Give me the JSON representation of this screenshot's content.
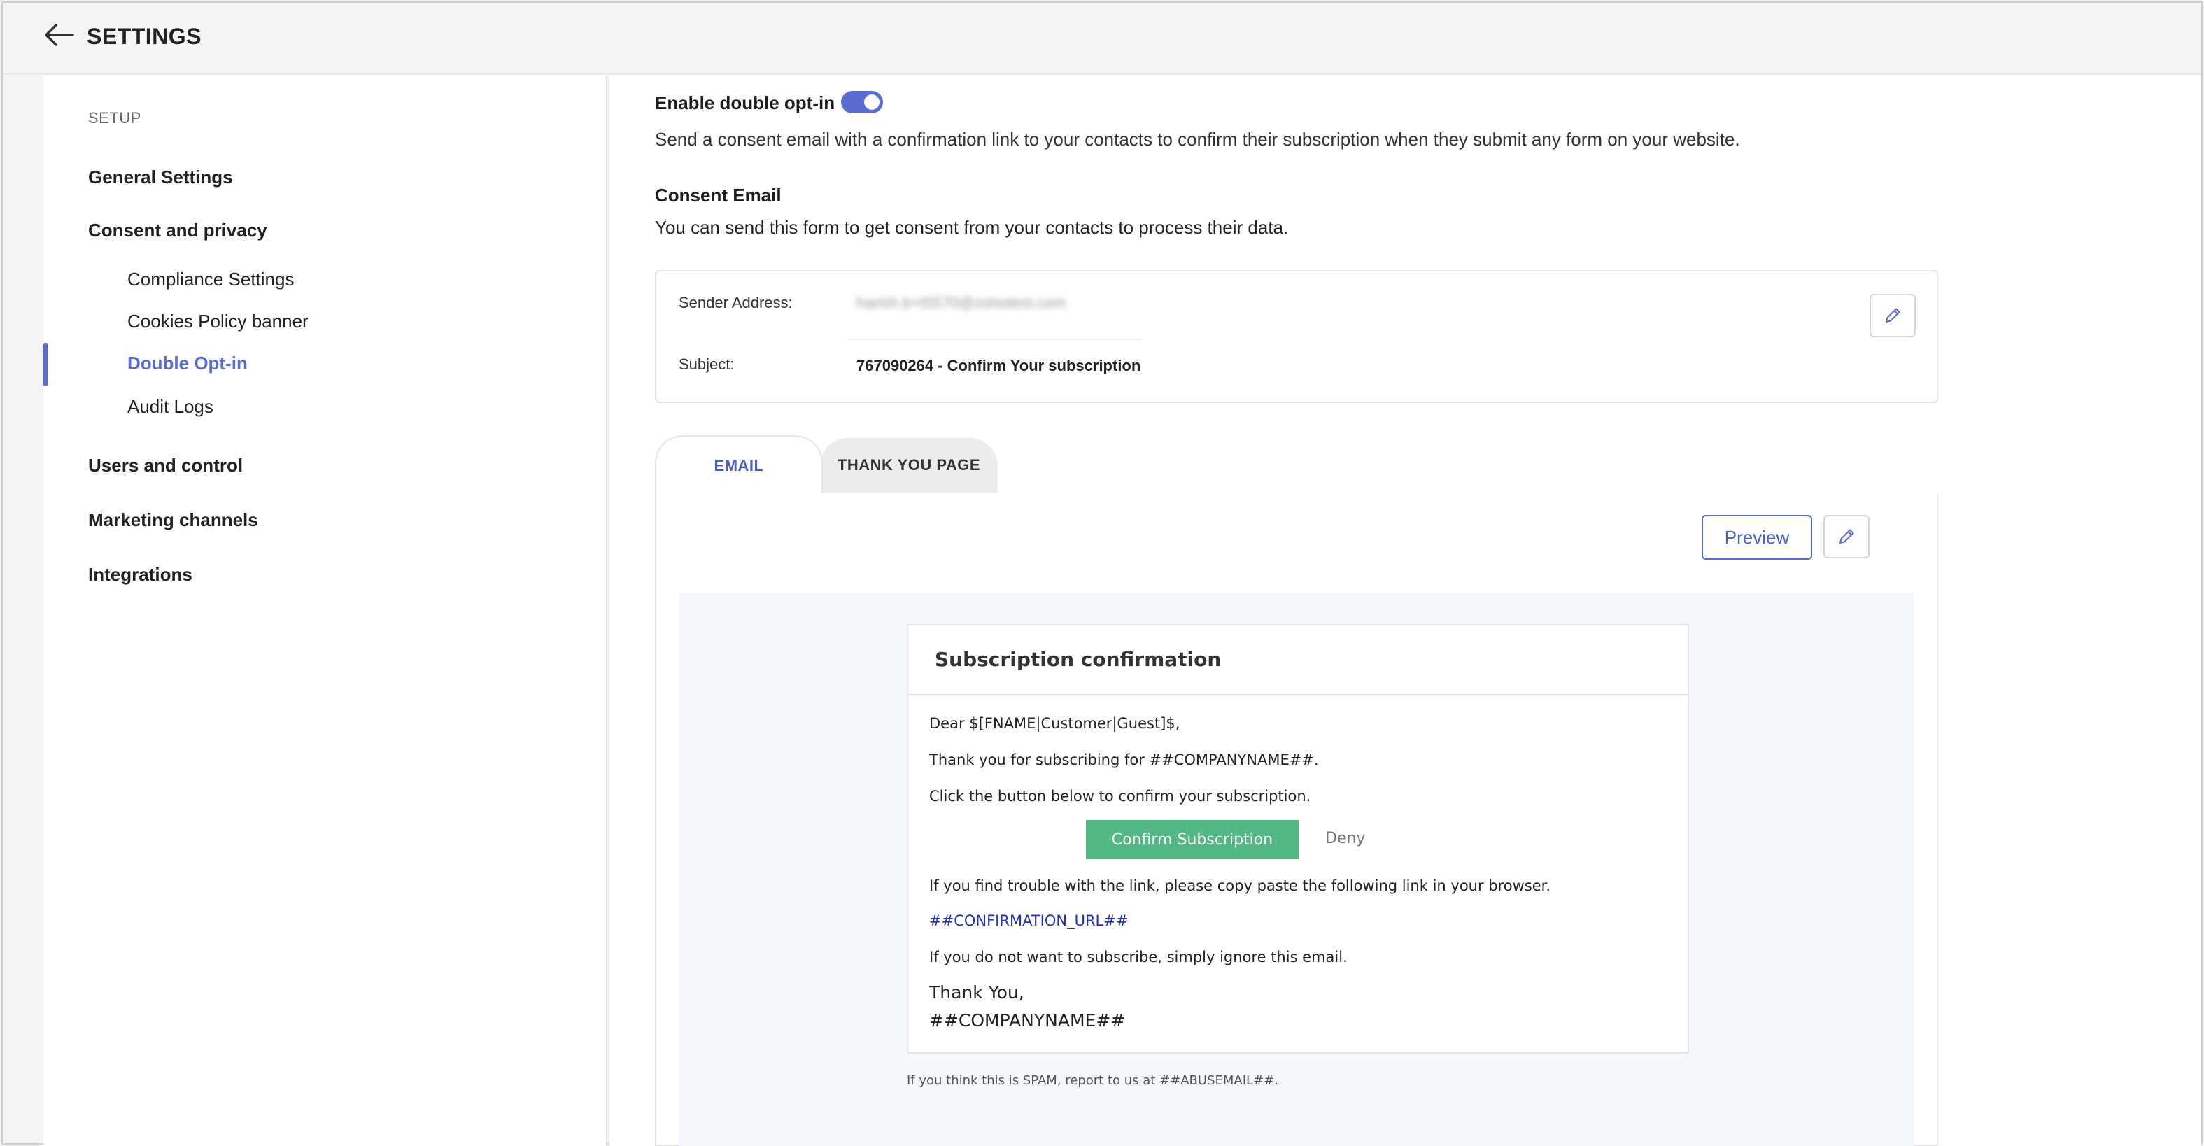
{
  "header": {
    "title": "SETTINGS"
  },
  "sidebar": {
    "section": "SETUP",
    "groups": [
      {
        "label": "General Settings"
      },
      {
        "label": "Consent and privacy"
      },
      {
        "label": "Users and control"
      },
      {
        "label": "Marketing channels"
      },
      {
        "label": "Integrations"
      }
    ],
    "consent_items": [
      {
        "label": "Compliance Settings"
      },
      {
        "label": "Cookies Policy banner"
      },
      {
        "label": "Double Opt-in",
        "active": true
      },
      {
        "label": "Audit Logs"
      }
    ]
  },
  "optin": {
    "title": "Enable double opt-in",
    "enabled": true,
    "description": "Send a consent email with a confirmation link to your contacts to confirm their subscription when they submit any form on your website."
  },
  "consent": {
    "title": "Consent Email",
    "description": "You can send this form to get consent from your contacts to process their data.",
    "sender_label": "Sender Address:",
    "sender_value": "harish.b+t5570@zohotest.com",
    "subject_label": "Subject:",
    "subject_value": "767090264 - Confirm Your subscription"
  },
  "tabs": [
    {
      "label": "EMAIL",
      "active": true
    },
    {
      "label": "THANK YOU PAGE",
      "active": false
    }
  ],
  "actions": {
    "preview_label": "Preview"
  },
  "email": {
    "title": "Subscription confirmation",
    "greeting": "Dear $[FNAME|Customer|Guest]$,",
    "thanks_line": "Thank you for subscribing for ##COMPANYNAME##.",
    "instruction": "Click the button below to confirm your subscription.",
    "confirm_label": "Confirm Subscription",
    "deny_label": "Deny",
    "trouble_line": "If you find trouble with the link, please copy paste the following link in your browser.",
    "confirmation_url": "##CONFIRMATION_URL##",
    "ignore_line": "If you do not want to subscribe, simply ignore this email.",
    "sign_off": "Thank You,",
    "signature": "##COMPANYNAME##",
    "spam_note": "If you think this is SPAM, report to us at ##ABUSEMAIL##."
  },
  "colors": {
    "accent": "#5b6cd1",
    "confirm_button": "#52b886",
    "link": "#2033b8"
  },
  "icons": {
    "back": "arrow-left-icon",
    "edit": "pencil-icon"
  }
}
